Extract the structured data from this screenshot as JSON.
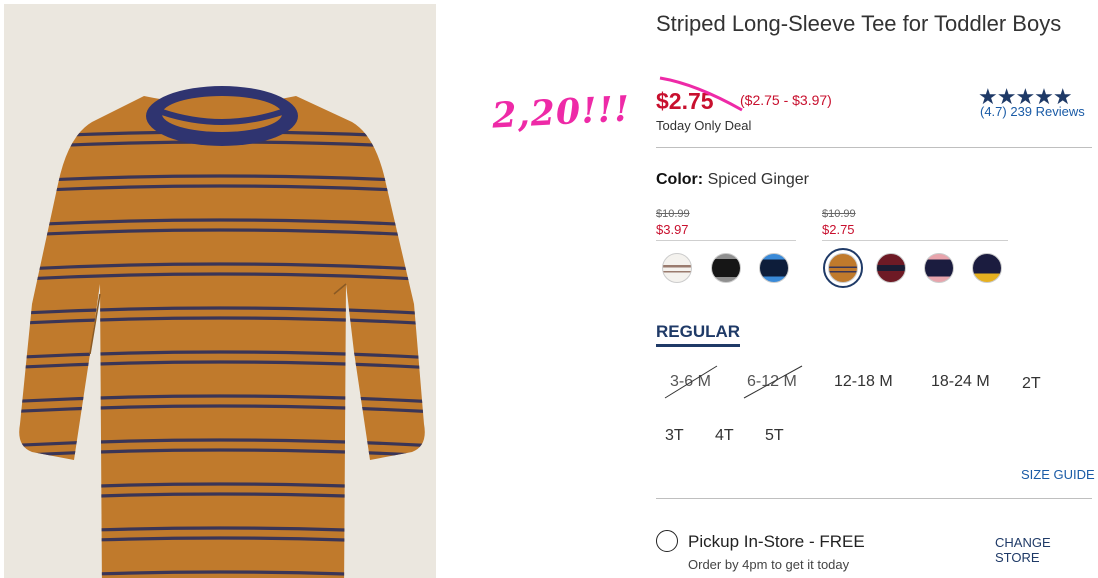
{
  "product": {
    "title": "Striped Long-Sleeve Tee for Toddler Boys",
    "price_now": "$2.75",
    "price_range": "($2.75 - $3.97)",
    "deal_text": "Today Only Deal",
    "annotation": "2,20!!!",
    "rating_stars": "★★★★★",
    "rating_text": "(4.7) 239 Reviews",
    "rating_value": 4.7
  },
  "color": {
    "label": "Color:",
    "selected": "Spiced Ginger",
    "groups": [
      {
        "was": "$10.99",
        "now": "$3.97",
        "swatches": [
          "white-stripe",
          "black-stripe",
          "blue-stripe"
        ]
      },
      {
        "was": "$10.99",
        "now": "$2.75",
        "swatches": [
          "spiced-ginger",
          "burgundy-stripe",
          "navy-pink-stripe",
          "navy-yellow-stripe"
        ]
      }
    ]
  },
  "fit": {
    "label": "REGULAR"
  },
  "sizes": {
    "row1": [
      "3-6 M",
      "6-12 M",
      "12-18 M",
      "18-24 M",
      "2T"
    ],
    "row2": [
      "3T",
      "4T",
      "5T"
    ],
    "unavailable": [
      "3-6 M",
      "6-12 M"
    ]
  },
  "size_guide": "SIZE GUIDE",
  "fulfillment": {
    "pickup_label": "Pickup In-Store - FREE",
    "pickup_sub": "Order by 4pm to get it today",
    "change_store": "CHANGE STORE"
  },
  "colors": {
    "sale_red": "#c8102e",
    "navy": "#1f3a67",
    "link_blue": "#1a5ba6",
    "annotation_pink": "#ee2aa7"
  }
}
